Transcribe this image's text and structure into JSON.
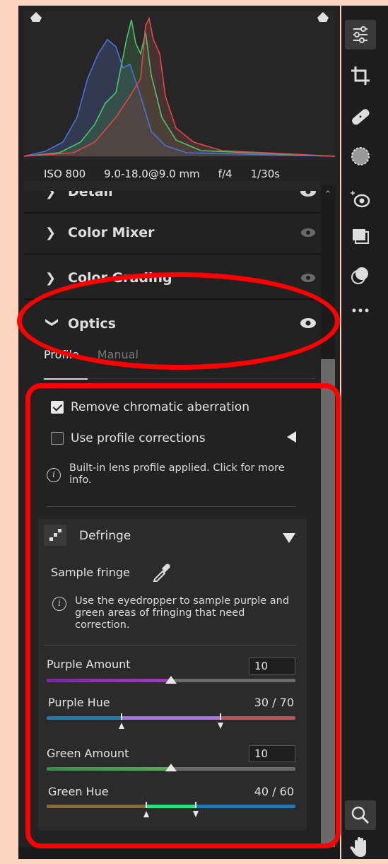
{
  "exif": {
    "iso": "ISO 800",
    "focal": "9.0-18.0@9.0 mm",
    "aperture": "f/4",
    "shutter": "1/30s"
  },
  "sections": {
    "detail": "Detail",
    "color_mixer": "Color Mixer",
    "color_grading": "Color Grading",
    "optics": "Optics"
  },
  "optics": {
    "tabs": {
      "profile": "Profile",
      "manual": "Manual"
    },
    "remove_ca": {
      "label": "Remove chromatic aberration",
      "checked": true
    },
    "profile_corrections": {
      "label": "Use profile corrections",
      "checked": false
    },
    "info_text": "Built-in lens profile applied.  Click for more info."
  },
  "defringe": {
    "title": "Defringe",
    "sample_label": "Sample fringe",
    "info_text": "Use the eyedropper to sample purple and green areas of fringing that need correction.",
    "purple_amount": {
      "label": "Purple Amount",
      "value": "10",
      "fraction": 0.5
    },
    "purple_hue": {
      "label": "Purple Hue",
      "value": "30 / 70",
      "low": 30,
      "high": 70
    },
    "green_amount": {
      "label": "Green Amount",
      "value": "10",
      "fraction": 0.5
    },
    "green_hue": {
      "label": "Green Hue",
      "value": "40 / 60",
      "low": 40,
      "high": 60
    }
  },
  "icons": {
    "toolbar": [
      "sliders-icon",
      "crop-icon",
      "healing-bandage-icon",
      "masking-icon",
      "red-eye-icon",
      "presets-icon",
      "snapshots-icon",
      "more-icon",
      "zoom-icon",
      "hand-icon"
    ]
  },
  "colors": {
    "annotation": "#ff0000",
    "histogram_red": "#e04848",
    "histogram_green": "#4cc56a",
    "histogram_blue": "#4a72d8"
  }
}
